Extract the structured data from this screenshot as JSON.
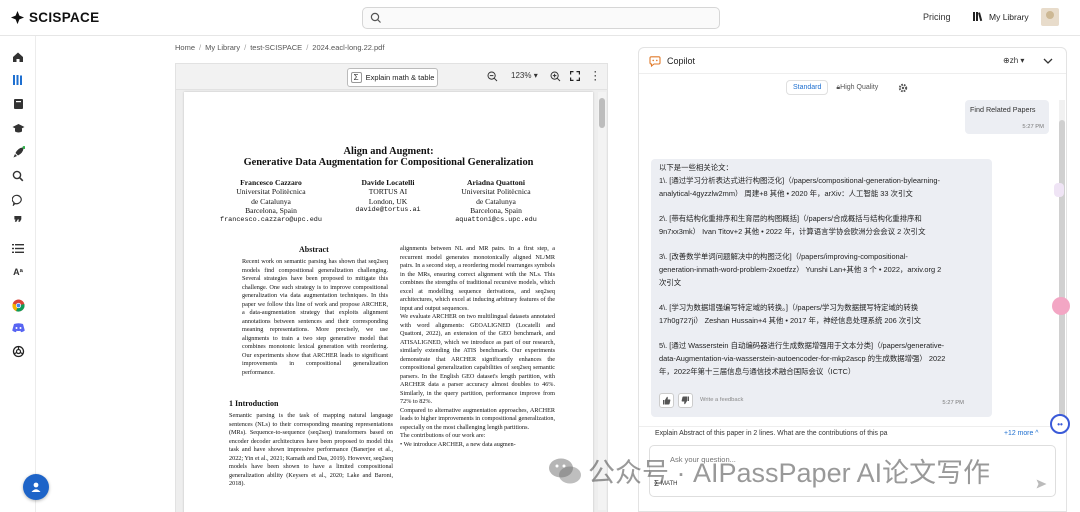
{
  "brand": {
    "name": "SCISPACE"
  },
  "search": {
    "placeholder": ""
  },
  "topnav": {
    "pricing": "Pricing",
    "my_library": "My Library"
  },
  "breadcrumb": [
    "Home",
    "My Library",
    "test-SCISPACE",
    "2024.eacl-long.22.pdf"
  ],
  "pdf_toolbar": {
    "explain_label": "Explain math & table",
    "zoom": "123%"
  },
  "paper": {
    "title_line1": "Align and Augment:",
    "title_line2": "Generative Data Augmentation for Compositional Generalization",
    "authors": [
      {
        "name": "Francesco Cazzaro",
        "l1": "Universitat Politècnica",
        "l2": "de Catalunya",
        "l3": "Barcelona, Spain",
        "email": "francesco.cazzaro@upc.edu"
      },
      {
        "name": "Davide Locatelli",
        "l1": "TORTUS AI",
        "l2": "London, UK",
        "l3": "",
        "email": "davide@tortus.ai"
      },
      {
        "name": "Ariadna Quattoni",
        "l1": "Universitat Politècnica",
        "l2": "de Catalunya",
        "l3": "Barcelona, Spain",
        "email": "aquattoni@cs.upc.edu"
      }
    ],
    "abstract_heading": "Abstract",
    "abstract_text": "Recent work on semantic parsing has shown that seq2seq models find compositional generalization challenging. Several strategies have been proposed to mitigate this challenge. One such strategy is to improve compositional generalization via data augmentation techniques. In this paper we follow this line of work and propose ARCHER, a data-augmentation strategy that exploits alignment annotations between sentences and their corresponding meaning representations. More precisely, we use alignments to train a two step generative model that combines monotonic lexical generation with reordering. Our experiments show that ARCHER leads to significant improvements in compositional generalization performance.",
    "intro_heading": "1   Introduction",
    "intro_text": "Semantic parsing is the task of mapping natural language sentences (NLs) to their corresponding meaning representations (MRs). Sequence-to-sequence (seq2seq) transformers based on encoder decoder architectures have been proposed to model this task and have shown impressive performance (Banerjee et al., 2022; Yin et al., 2021; Kamath and Das, 2019). However, seq2seq models have been shown to have a limited compositional generalization ability (Keysers et al., 2020; Lake and Baroni, 2018).",
    "right_col_text": "alignments between NL and MR pairs. In a first step, a recurrent model generates monotonically aligned NL/MR pairs. In a second step, a reordering model rearranges symbols in the MRs, ensuring correct alignment with the NLs. This combines the strengths of traditional recursive models, which excel at modelling sequence derivations, and seq2seq architectures, which excel at inducing arbitrary features of the input and output sequences.\nWe evaluate ARCHER on two multilingual datasets annotated with word alignments: GEOALIGNED (Locatelli and Quattoni, 2022), an extension of the GEO benchmark, and ATISALIGNED, which we introduce as part of our research, similarly extending the ATIS benchmark. Our experiments demonstrate that ARCHER significantly enhances the compositional generalization capabilities of seq2seq semantic parsers. In the English GEO dataset's length partition, with ARCHER data a parser accuracy almost doubles to 46%. Similarly, in the query partition, performance improve from 72% to 82%.\nCompared to alternative augmentation approaches, ARCHER leads to higher improvements in compositional generalization, especially on the most challenging length partitions.\nThe contributions of our work are:\n• We introduce ARCHER, a new data augmen-"
  },
  "copilot": {
    "title": "Copilot",
    "lang": "zh",
    "modes": {
      "standard": "Standard",
      "high_quality": "High Quality"
    },
    "user_msg": {
      "text": "Find Related Papers",
      "time": "5:27 PM"
    },
    "bot_msg": {
      "lines": [
        "以下是一些相关论文：",
        "1\\. [通过学习分析表达式进行构图泛化]（/papers/compositional-generation-bylearning-",
        "analytical-4gyzzlw2mm） 周建+8 其他 • 2020 年，arXiv：人工智能 33 次引文",
        "2\\. [带有结构化重排序和生育层的构图概括]（/papers/合成概括与结构化重排序和",
        "9n7xx3mk） Ivan Titov+2 其他 • 2022 年，计算语言学协会欧洲分会会议 2 次引文",
        "3\\. [改善数学单词问题解决中的构图泛化]（/papers/improving-compositional-",
        "generation-inmath-word-problem-2xoetfzz） Yunshi Lan+其他 3 个 • 2022，arxiv.org 2",
        "次引文",
        "4\\. [学习为数据增强编写特定域的转换。]（/papers/学习为数据撰写特定域的转换",
        "17h0g727ji） Zeshan Hussain+4 其他 • 2017 年，神经信息处理系统 206 次引文",
        "5\\. [通过 Wasserstein 自动编码器进行生成数据增强用于文本分类]（/papers/generative-",
        "data-Augmentation-via-wasserstein-autoencoder-for-mkp2ascp 的生成数据增强） 2022",
        "年，2022年第十三届信息与通信技术融合国际会议（ICTC）"
      ],
      "feedback_label": "Write a feedback",
      "time": "5:27 PM"
    },
    "suggestion": "Explain Abstract of this paper in 2 lines. What are the contributions of this pa",
    "more_label": "+12 more",
    "input_placeholder": "Ask your question...",
    "math_label": "MATH"
  },
  "watermark": {
    "text": "公众号 · AIPassPaper AI论文写作"
  },
  "colors": {
    "accent": "#1e6fd0",
    "bubble": "#eceef3",
    "fab": "#1e64c8"
  },
  "icons": [
    "home-icon",
    "library-icon",
    "notebook-icon",
    "graduation-cap-icon",
    "rocket-icon",
    "search-icon",
    "chat-icon",
    "quote-icon",
    "list-icon",
    "translate-icon",
    "chrome-icon",
    "discord-icon",
    "openai-icon"
  ]
}
